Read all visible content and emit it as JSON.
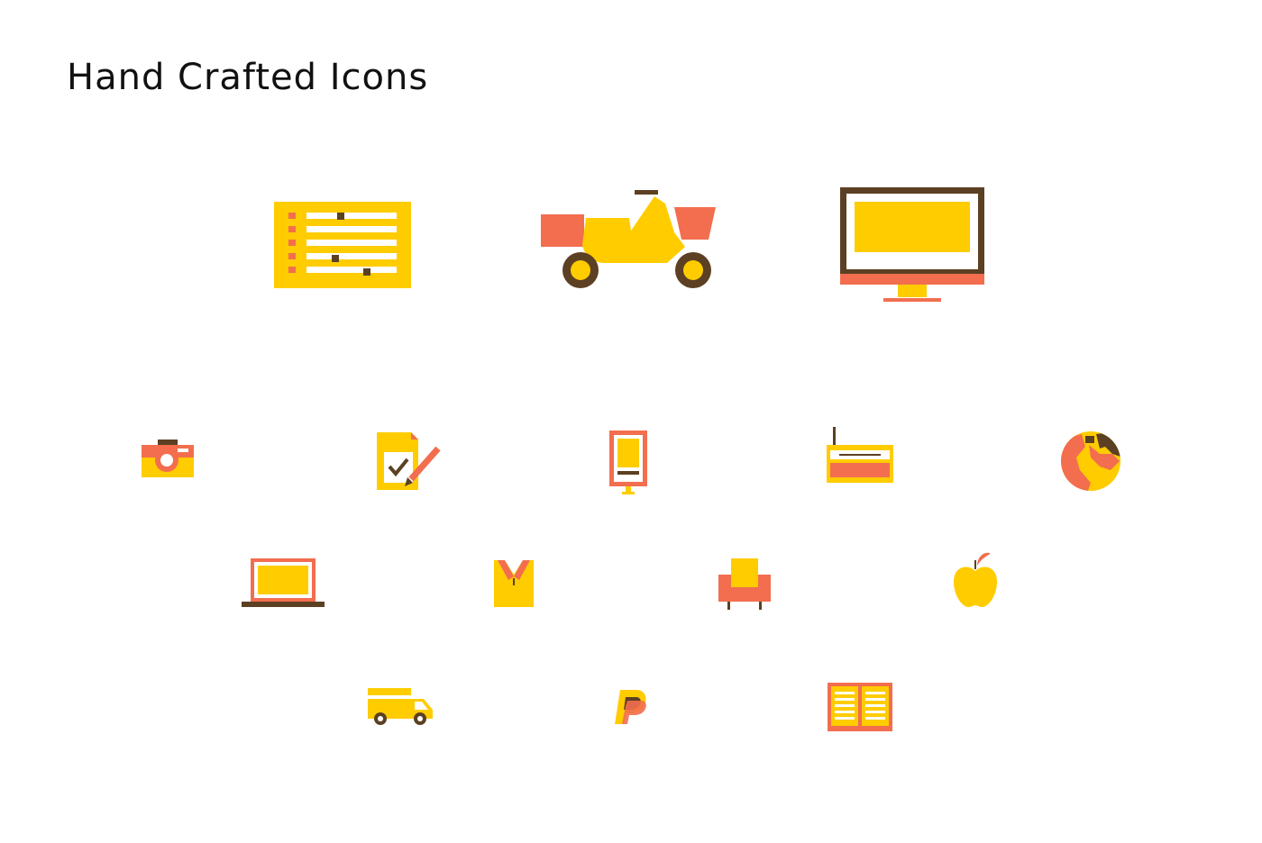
{
  "header": {
    "title": "Hand Crafted Icons"
  },
  "colors": {
    "yellow": "#FFCC00",
    "coral": "#F26E4F",
    "brown": "#5C4023",
    "white": "#FFFFFF"
  },
  "icons": [
    "schedule-list-icon",
    "delivery-scooter-icon",
    "desktop-monitor-icon",
    "camera-icon",
    "checklist-pencil-icon",
    "mobile-phone-icon",
    "radio-icon",
    "globe-icon",
    "laptop-icon",
    "shirt-icon",
    "armchair-icon",
    "apple-icon",
    "delivery-truck-icon",
    "paypal-icon",
    "open-book-icon"
  ]
}
